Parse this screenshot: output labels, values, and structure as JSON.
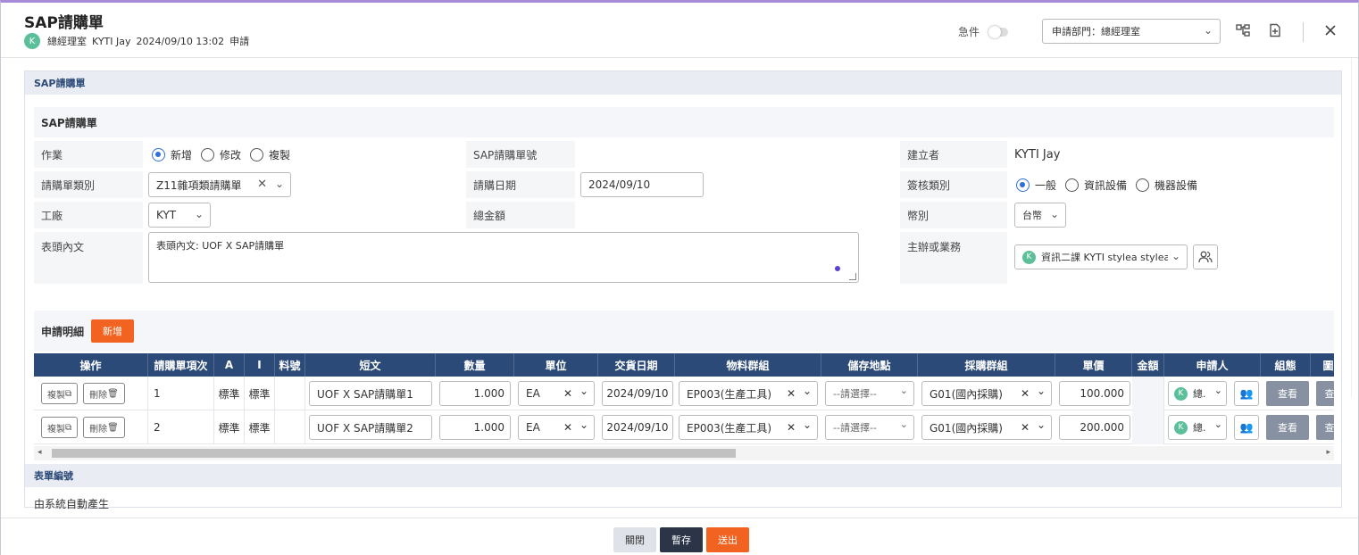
{
  "header": {
    "title": "SAP請購單",
    "avatar_letter": "K",
    "department": "總經理室",
    "user": "KYTI Jay",
    "datetime": "2024/09/10 13:02",
    "action": "申請",
    "urgent_label": "急件",
    "dept_select": "申請部門：總經理室"
  },
  "section_title": "SAP請購單",
  "inner_title": "SAP請購單",
  "form": {
    "operation_label": "作業",
    "operation_options": [
      "新增",
      "修改",
      "複製"
    ],
    "operation_selected": "新增",
    "sap_no_label": "SAP請購單號",
    "sap_no_value": "",
    "creator_label": "建立者",
    "creator_value": "KYTI Jay",
    "pr_type_label": "請購單類別",
    "pr_type_value": "Z11雜項類請購單",
    "pr_date_label": "請購日期",
    "pr_date_value": "2024/09/10",
    "approval_label": "簽核類別",
    "approval_options": [
      "一般",
      "資訊設備",
      "機器設備"
    ],
    "approval_selected": "一般",
    "plant_label": "工廠",
    "plant_value": "KYT",
    "total_label": "總金額",
    "total_value": "",
    "currency_label": "幣別",
    "currency_value": "台幣",
    "header_text_label": "表頭內文",
    "header_text_value": "表頭內文: UOF X SAP請購單",
    "owner_label": "主辦或業務",
    "owner_avatar": "K",
    "owner_value": "資訊二課 KYTI stylea  stylea"
  },
  "detail": {
    "title": "申請明細",
    "add_label": "新增",
    "columns": [
      "操作",
      "請購單項次",
      "A",
      "I",
      "料號",
      "短文",
      "數量",
      "單位",
      "交貨日期",
      "物料群組",
      "儲存地點",
      "採購群組",
      "單價",
      "金額",
      "申請人",
      "組態",
      "圖"
    ],
    "copy_label": "複製",
    "delete_label": "刪除",
    "view_label": "查看",
    "rows": [
      {
        "item": "1",
        "a": "標準",
        "i": "標準",
        "part": "",
        "short_text": "UOF X SAP請購單1",
        "qty": "1.000",
        "unit": "EA",
        "delivery": "2024/09/10",
        "material_group": "EP003(生產工具)",
        "storage": "--請選擇--",
        "purchasing_group": "G01(國內採購)",
        "price": "100.000",
        "amount": "",
        "applicant_avatar": "K",
        "applicant": "總."
      },
      {
        "item": "2",
        "a": "標準",
        "i": "標準",
        "part": "",
        "short_text": "UOF X SAP請購單2",
        "qty": "1.000",
        "unit": "EA",
        "delivery": "2024/09/10",
        "material_group": "EP003(生產工具)",
        "storage": "--請選擇--",
        "purchasing_group": "G01(國內採購)",
        "price": "200.000",
        "amount": "",
        "applicant_avatar": "K",
        "applicant": "總."
      }
    ]
  },
  "form_no": {
    "title": "表單編號",
    "value": "由系統自動產生"
  },
  "footer": {
    "close_label": "關閉",
    "save_label": "暫存",
    "submit_label": "送出"
  },
  "colors": {
    "accent_orange": "#f26322",
    "header_navy": "#2c4a78",
    "save_dark": "#2b3547",
    "radio_blue": "#2f6fd6"
  }
}
